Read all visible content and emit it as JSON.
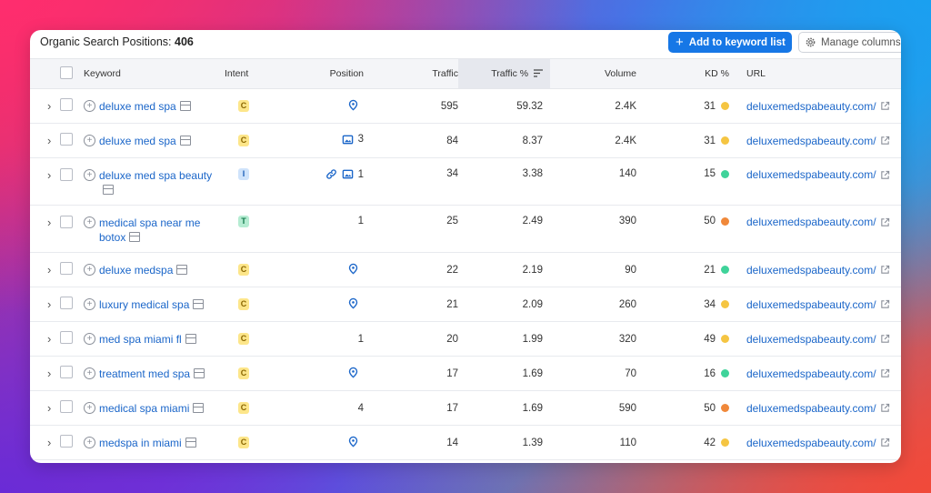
{
  "header": {
    "title_prefix": "Organic Search Positions:",
    "title_count": "406",
    "add_button": "Add to keyword list",
    "add_icon": "+",
    "manage_button": "Manage columns"
  },
  "columns": {
    "keyword": "Keyword",
    "intent": "Intent",
    "position": "Position",
    "traffic": "Traffic",
    "traffic_pct": "Traffic %",
    "volume": "Volume",
    "kd": "KD %",
    "url": "URL"
  },
  "colors": {
    "accent": "#1677e6",
    "link": "#1b66c9",
    "kd_easy": "#3fd39a",
    "kd_possible": "#f5c542",
    "kd_difficult": "#f0883a",
    "intent_c_bg": "#fde68a",
    "intent_i_bg": "#cfe3fb",
    "intent_t_bg": "#b5ecd2"
  },
  "rows": [
    {
      "keyword": "deluxe med spa",
      "intent": "C",
      "position_icons": [
        "location-pin-icon"
      ],
      "position": "",
      "traffic": "595",
      "traffic_pct": "59.32",
      "volume": "2.4K",
      "kd": "31",
      "kd_level": "possible",
      "url": "deluxemedspabeauty.com/"
    },
    {
      "keyword": "deluxe med spa",
      "intent": "C",
      "position_icons": [
        "image-icon"
      ],
      "position": "3",
      "traffic": "84",
      "traffic_pct": "8.37",
      "volume": "2.4K",
      "kd": "31",
      "kd_level": "possible",
      "url": "deluxemedspabeauty.com/"
    },
    {
      "keyword": "deluxe med spa beauty",
      "intent": "I",
      "position_icons": [
        "link-icon",
        "image-icon"
      ],
      "position": "1",
      "traffic": "34",
      "traffic_pct": "3.38",
      "volume": "140",
      "kd": "15",
      "kd_level": "easy",
      "url": "deluxemedspabeauty.com/"
    },
    {
      "keyword": "medical spa near me botox",
      "intent": "T",
      "position_icons": [],
      "position": "1",
      "traffic": "25",
      "traffic_pct": "2.49",
      "volume": "390",
      "kd": "50",
      "kd_level": "difficult",
      "url": "deluxemedspabeauty.com/"
    },
    {
      "keyword": "deluxe medspa",
      "intent": "C",
      "position_icons": [
        "location-pin-icon"
      ],
      "position": "",
      "traffic": "22",
      "traffic_pct": "2.19",
      "volume": "90",
      "kd": "21",
      "kd_level": "easy",
      "url": "deluxemedspabeauty.com/"
    },
    {
      "keyword": "luxury medical spa",
      "intent": "C",
      "position_icons": [
        "location-pin-icon"
      ],
      "position": "",
      "traffic": "21",
      "traffic_pct": "2.09",
      "volume": "260",
      "kd": "34",
      "kd_level": "possible",
      "url": "deluxemedspabeauty.com/"
    },
    {
      "keyword": "med spa miami fl",
      "intent": "C",
      "position_icons": [],
      "position": "1",
      "traffic": "20",
      "traffic_pct": "1.99",
      "volume": "320",
      "kd": "49",
      "kd_level": "possible",
      "url": "deluxemedspabeauty.com/"
    },
    {
      "keyword": "treatment med spa",
      "intent": "C",
      "position_icons": [
        "location-pin-icon"
      ],
      "position": "",
      "traffic": "17",
      "traffic_pct": "1.69",
      "volume": "70",
      "kd": "16",
      "kd_level": "easy",
      "url": "deluxemedspabeauty.com/"
    },
    {
      "keyword": "medical spa miami",
      "intent": "C",
      "position_icons": [],
      "position": "4",
      "traffic": "17",
      "traffic_pct": "1.69",
      "volume": "590",
      "kd": "50",
      "kd_level": "difficult",
      "url": "deluxemedspabeauty.com/"
    },
    {
      "keyword": "medspa in miami",
      "intent": "C",
      "position_icons": [
        "location-pin-icon"
      ],
      "position": "",
      "traffic": "14",
      "traffic_pct": "1.39",
      "volume": "110",
      "kd": "42",
      "kd_level": "possible",
      "url": "deluxemedspabeauty.com/"
    }
  ]
}
